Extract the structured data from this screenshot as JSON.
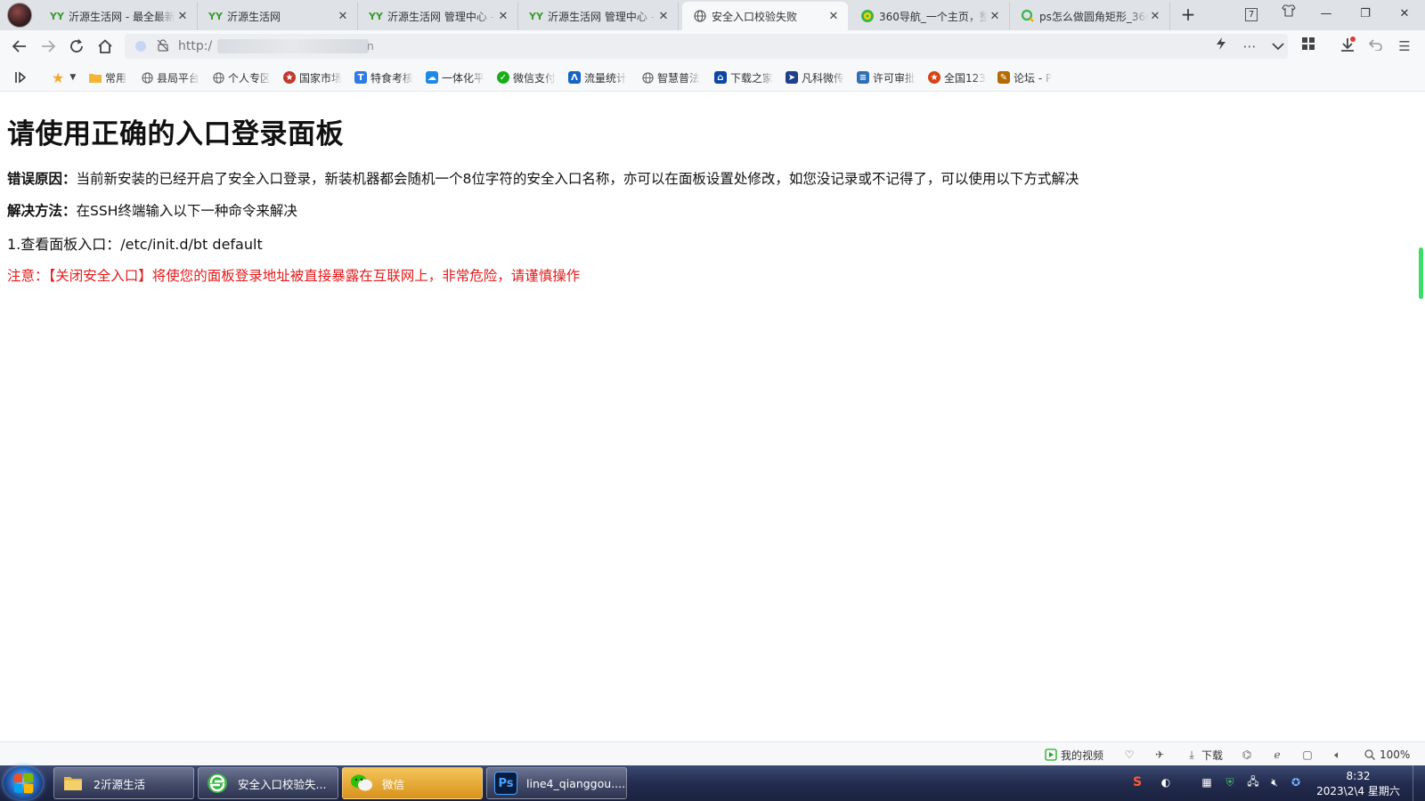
{
  "browser": {
    "tabs": [
      {
        "title": "沂源生活网 - 最全最新",
        "icon": "yy-logo-icon",
        "active": false
      },
      {
        "title": "沂源生活网",
        "icon": "yy-logo-icon",
        "active": false
      },
      {
        "title": "沂源生活网 管理中心 - ",
        "icon": "yy-logo-icon",
        "active": false
      },
      {
        "title": "沂源生活网 管理中心 - ",
        "icon": "yy-logo-icon",
        "active": false
      },
      {
        "title": "安全入口校验失败",
        "icon": "globe-icon",
        "active": true
      },
      {
        "title": "360导航_一个主页，整",
        "icon": "360-icon",
        "active": false
      },
      {
        "title": "ps怎么做圆角矩形_360",
        "icon": "360-search-icon",
        "active": false
      }
    ],
    "tab_close_glyph": "✕",
    "new_tab_glyph": "+",
    "window_controls": {
      "minimize": "—",
      "restore": "❐",
      "close": "✕",
      "tab_count": "7"
    },
    "url_prefix": "http:/",
    "url_tail": "n",
    "bookmarks": [
      {
        "label": "常用",
        "icon": "folder-icon",
        "color": "#f2b632"
      },
      {
        "label": "县局平台",
        "icon": "globe-icon",
        "color": "#777777"
      },
      {
        "label": "个人专区",
        "icon": "globe-icon",
        "color": "#777777"
      },
      {
        "label": "国家市场",
        "icon": "emblem-icon",
        "color": "#c0392b"
      },
      {
        "label": "特食考核",
        "icon": "t-icon",
        "color": "#2d7be5"
      },
      {
        "label": "一体化平",
        "icon": "cloud-icon",
        "color": "#1e88e5"
      },
      {
        "label": "微信支付",
        "icon": "wechat-pay-icon",
        "color": "#1aad19"
      },
      {
        "label": "流量统计",
        "icon": "stats-icon",
        "color": "#1565c0"
      },
      {
        "label": "智慧普法",
        "icon": "globe-icon",
        "color": "#777777"
      },
      {
        "label": "下载之家",
        "icon": "house-icon",
        "color": "#0d47a1"
      },
      {
        "label": "凡科微传",
        "icon": "arrow-cursor-icon",
        "color": "#1e3f8a"
      },
      {
        "label": "许可审批",
        "icon": "doc-icon",
        "color": "#2f6fb5"
      },
      {
        "label": "全国123",
        "icon": "emblem-icon",
        "color": "#d84315"
      },
      {
        "label": "论坛 - P",
        "icon": "forum-icon",
        "color": "#b36b00"
      }
    ]
  },
  "page": {
    "heading": "请使用正确的入口登录面板",
    "error_label": "错误原因：",
    "error_text": "当前新安装的已经开启了安全入口登录，新装机器都会随机一个8位字符的安全入口名称，亦可以在面板设置处修改，如您没记录或不记得了，可以使用以下方式解决",
    "solution_label": "解决方法：",
    "solution_text": "在SSH终端输入以下一种命令来解决",
    "step1": "1.查看面板入口：/etc/init.d/bt default",
    "warning": "注意：【关闭安全入口】将使您的面板登录地址被直接暴露在互联网上，非常危险，请谨慎操作",
    "warning_color": "#e11b1b"
  },
  "statusbar": {
    "my_video": "我的视频",
    "download": "下载",
    "zoom": "100%"
  },
  "taskbar": {
    "items": [
      {
        "label": "2沂源生活",
        "icon": "folder-icon"
      },
      {
        "label": "安全入口校验失...",
        "icon": "360-browser-icon"
      },
      {
        "label": "微信",
        "icon": "wechat-icon"
      },
      {
        "label": "line4_qianggou....",
        "icon": "photoshop-icon"
      }
    ],
    "time": "8:32",
    "date": "2023\\2\\4 星期六"
  }
}
